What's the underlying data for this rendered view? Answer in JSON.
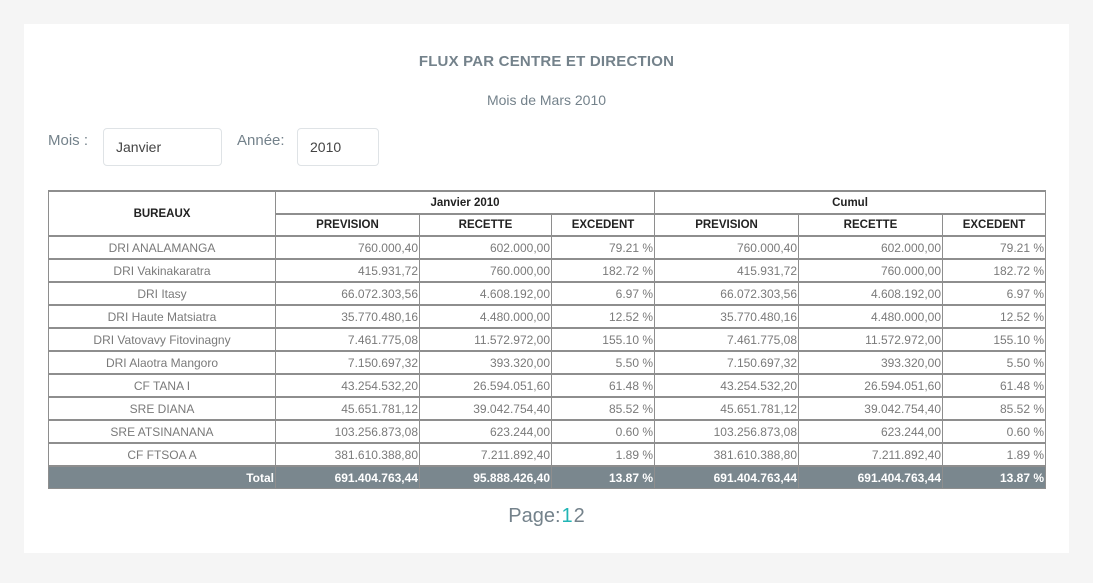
{
  "title": "FLUX PAR CENTRE ET DIRECTION",
  "subtitle": "Mois de Mars 2010",
  "filters": {
    "mois_label": "Mois :",
    "mois_value": "Janvier",
    "annee_label": "Année:",
    "annee_value": "2010"
  },
  "table": {
    "col_bureaux": "BUREAUX",
    "group_month": "Janvier 2010",
    "group_cumul": "Cumul",
    "sub_prevision": "PREVISION",
    "sub_recette": "RECETTE",
    "sub_excedent": "EXCEDENT",
    "rows": [
      {
        "name": "DRI ANALAMANGA",
        "p1": "760.000,40",
        "r1": "602.000,00",
        "e1": "79.21 %",
        "p2": "760.000,40",
        "r2": "602.000,00",
        "e2": "79.21 %"
      },
      {
        "name": "DRI Vakinakaratra",
        "p1": "415.931,72",
        "r1": "760.000,00",
        "e1": "182.72 %",
        "p2": "415.931,72",
        "r2": "760.000,00",
        "e2": "182.72 %"
      },
      {
        "name": "DRI Itasy",
        "p1": "66.072.303,56",
        "r1": "4.608.192,00",
        "e1": "6.97 %",
        "p2": "66.072.303,56",
        "r2": "4.608.192,00",
        "e2": "6.97 %"
      },
      {
        "name": "DRI Haute Matsiatra",
        "p1": "35.770.480,16",
        "r1": "4.480.000,00",
        "e1": "12.52 %",
        "p2": "35.770.480,16",
        "r2": "4.480.000,00",
        "e2": "12.52 %"
      },
      {
        "name": "DRI Vatovavy Fitovinagny",
        "p1": "7.461.775,08",
        "r1": "11.572.972,00",
        "e1": "155.10 %",
        "p2": "7.461.775,08",
        "r2": "11.572.972,00",
        "e2": "155.10 %"
      },
      {
        "name": "DRI Alaotra Mangoro",
        "p1": "7.150.697,32",
        "r1": "393.320,00",
        "e1": "5.50 %",
        "p2": "7.150.697,32",
        "r2": "393.320,00",
        "e2": "5.50 %"
      },
      {
        "name": "CF TANA I",
        "p1": "43.254.532,20",
        "r1": "26.594.051,60",
        "e1": "61.48 %",
        "p2": "43.254.532,20",
        "r2": "26.594.051,60",
        "e2": "61.48 %"
      },
      {
        "name": "SRE DIANA",
        "p1": "45.651.781,12",
        "r1": "39.042.754,40",
        "e1": "85.52 %",
        "p2": "45.651.781,12",
        "r2": "39.042.754,40",
        "e2": "85.52 %"
      },
      {
        "name": "SRE ATSINANANA",
        "p1": "103.256.873,08",
        "r1": "623.244,00",
        "e1": "0.60 %",
        "p2": "103.256.873,08",
        "r2": "623.244,00",
        "e2": "0.60 %"
      },
      {
        "name": "CF FTSOA A",
        "p1": "381.610.388,80",
        "r1": "7.211.892,40",
        "e1": "1.89 %",
        "p2": "381.610.388,80",
        "r2": "7.211.892,40",
        "e2": "1.89 %"
      }
    ],
    "total": {
      "label": "Total",
      "p1": "691.404.763,44",
      "r1": "95.888.426,40",
      "e1": "13.87 %",
      "p2": "691.404.763,44",
      "r2": "691.404.763,44",
      "e2": "13.87 %"
    }
  },
  "pagination": {
    "label": "Page:",
    "pages": [
      "1",
      "2"
    ],
    "current": "1"
  },
  "colors": {
    "accent": "#21b5b5",
    "total_row_bg": "#7a878e",
    "muted_text": "#74828b"
  }
}
